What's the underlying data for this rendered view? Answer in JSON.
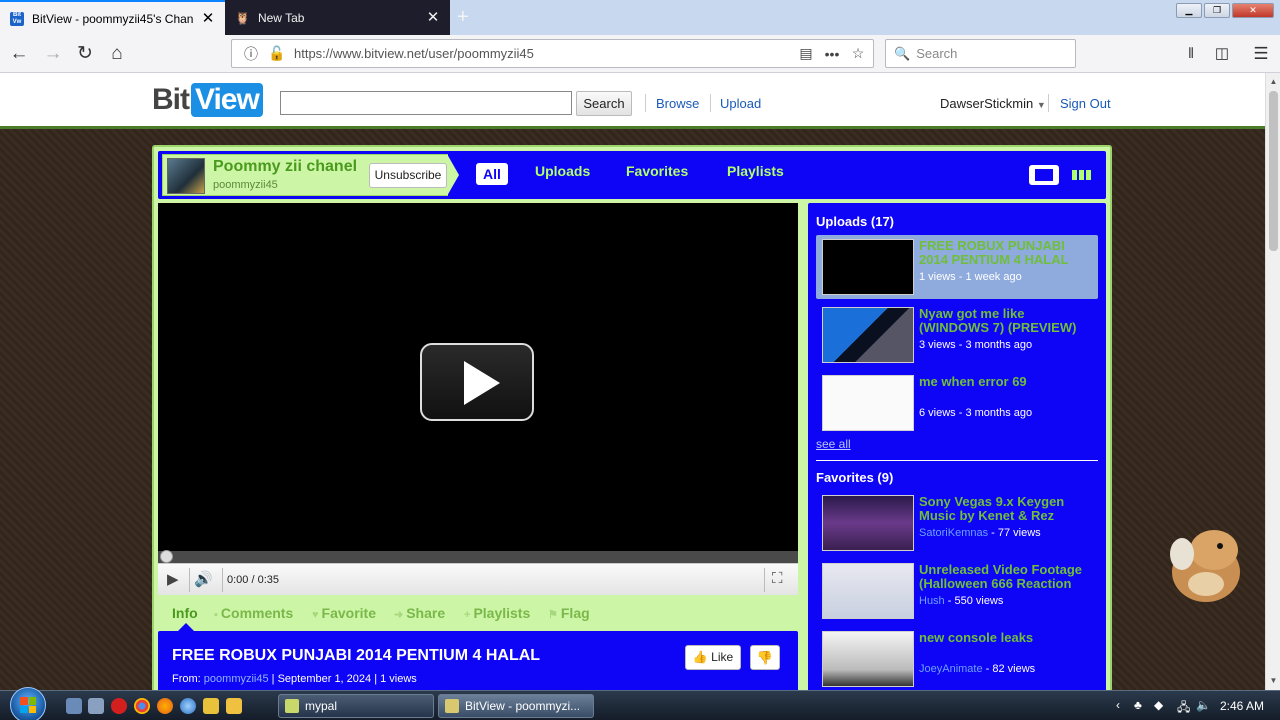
{
  "browser": {
    "tabs": [
      {
        "title": "BitView - poommyzii45's Chan"
      },
      {
        "title": "New Tab"
      }
    ],
    "url": "https://www.bitview.net/user/poommyzii45",
    "search_placeholder": "Search"
  },
  "site": {
    "logo_bit": "Bit",
    "logo_view": "View",
    "search_button": "Search",
    "nav": [
      "Browse",
      "Upload"
    ],
    "username": "DawserStickmin",
    "sign_out": "Sign Out"
  },
  "channel": {
    "name": "Poommy zii chanel",
    "username": "poommyzii45",
    "unsubscribe": "Unsubscribe",
    "tabs": [
      "All",
      "Uploads",
      "Favorites",
      "Playlists"
    ]
  },
  "player": {
    "time": "0:00 / 0:35"
  },
  "video_tabs": [
    "Info",
    "Comments",
    "Favorite",
    "Share",
    "Playlists",
    "Flag"
  ],
  "video": {
    "title": "FREE ROBUX PUNJABI 2014 PENTIUM 4 HALAL",
    "from_label": "From:",
    "from_user": "poommyzii45",
    "meta_rest": " | September 1, 2024 | 1 views",
    "like": "Like"
  },
  "sidebar": {
    "uploads_heading": "Uploads (17)",
    "uploads": [
      {
        "title": "FREE ROBUX PUNJABI 2014 PENTIUM 4 HALAL",
        "meta": "1 views - 1 week ago"
      },
      {
        "title": "Nyaw got me like (WINDOWS 7) (PREVIEW)",
        "meta": "3 views - 3 months ago"
      },
      {
        "title": "me when error 69",
        "meta": "6 views - 3 months ago"
      }
    ],
    "see_all": "see all",
    "favorites_heading": "Favorites (9)",
    "favorites": [
      {
        "title": "Sony Vegas 9.x Keygen Music by Kenet & Rez",
        "user": "SatoriKemnas",
        "views": " - 77 views"
      },
      {
        "title": "Unreleased Video Footage (Halloween 666 Reaction",
        "user": "Hush",
        "views": " - 550 views"
      },
      {
        "title": "new console leaks",
        "user": "JoeyAnimate",
        "views": " - 82 views"
      }
    ]
  },
  "taskbar": {
    "tasks": [
      "mypal",
      "BitView - poommyzi..."
    ],
    "clock": "2:46 AM"
  },
  "colors": {
    "channel_blue": "#0e04f6",
    "channel_green": "#ccf5a6",
    "link_green": "#6fbf3a",
    "tab_green": "#b0ff6e"
  }
}
